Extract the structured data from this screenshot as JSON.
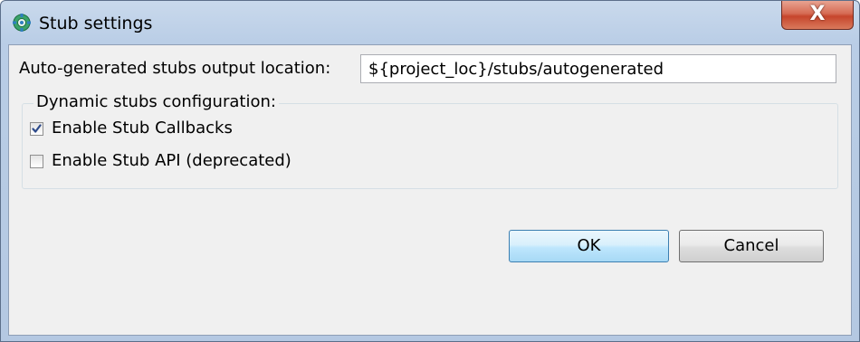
{
  "window": {
    "title": "Stub settings",
    "close_label": "X"
  },
  "output": {
    "label": "Auto-generated stubs output location:",
    "value": "${project_loc}/stubs/autogenerated"
  },
  "dynamic_group": {
    "title": "Dynamic stubs configuration:",
    "options": [
      {
        "label": "Enable Stub Callbacks",
        "checked": true
      },
      {
        "label": "Enable Stub API (deprecated)",
        "checked": false
      }
    ]
  },
  "buttons": {
    "ok": "OK",
    "cancel": "Cancel"
  },
  "colors": {
    "title_bar": "#b9cde6",
    "close_button": "#c6452c",
    "dialog_background": "#f0f0f0",
    "ok_button": "#bee6fd",
    "check_mark": "#2d4a8a"
  }
}
